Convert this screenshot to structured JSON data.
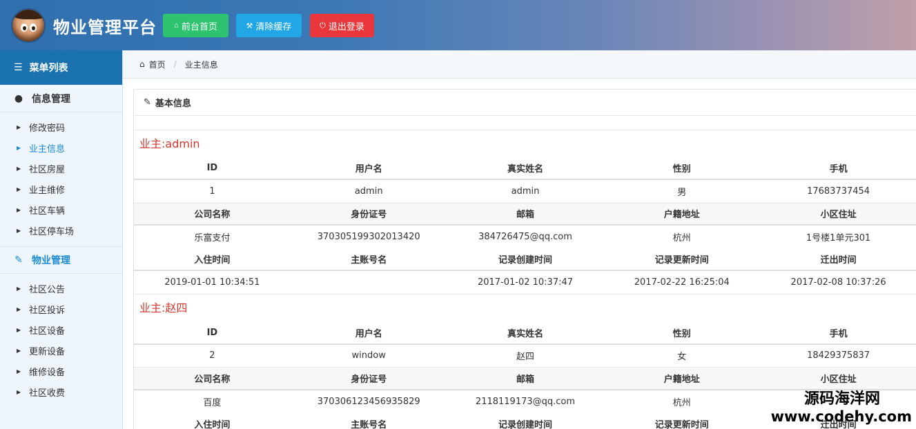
{
  "header": {
    "brand": "物业管理平台",
    "buttons": {
      "home": "前台首页",
      "cache": "清除缓存",
      "logout": "退出登录"
    }
  },
  "sidebar": {
    "title": "菜单列表",
    "groups": [
      {
        "label": "信息管理",
        "items": [
          "修改密码",
          "业主信息",
          "社区房屋",
          "业主维修",
          "社区车辆",
          "社区停车场"
        ]
      },
      {
        "label": "物业管理",
        "items": [
          "社区公告",
          "社区投诉",
          "社区设备",
          "更新设备",
          "维修设备",
          "社区收费"
        ]
      }
    ],
    "active_item": "业主信息"
  },
  "breadcrumb": {
    "home": "首页",
    "current": "业主信息"
  },
  "panel": {
    "title": "基本信息"
  },
  "headers": {
    "row1": [
      "ID",
      "用户名",
      "真实姓名",
      "性别",
      "手机"
    ],
    "row2": [
      "公司名称",
      "身份证号",
      "邮箱",
      "户籍地址",
      "小区住址"
    ],
    "row3": [
      "入住时间",
      "主账号名",
      "记录创建时间",
      "记录更新时间",
      "迁出时间"
    ]
  },
  "owners": [
    {
      "title": "业主:admin",
      "row1": [
        "1",
        "admin",
        "admin",
        "男",
        "17683737454"
      ],
      "row2": [
        "乐富支付",
        "370305199302013420",
        "384726475@qq.com",
        "杭州",
        "1号楼1单元301"
      ],
      "row3": [
        "2019-01-01 10:34:51",
        "",
        "2017-01-02 10:37:47",
        "2017-02-22 16:25:04",
        "2017-02-08 10:37:26"
      ]
    },
    {
      "title": "业主:赵四",
      "row1": [
        "2",
        "window",
        "赵四",
        "女",
        "18429375837"
      ],
      "row2": [
        "百度",
        "370306123456935829",
        "2118119173@qq.com",
        "杭州",
        ""
      ]
    }
  ],
  "watermark": {
    "line1": "源码海洋网",
    "line2": "www.codehy.com"
  }
}
